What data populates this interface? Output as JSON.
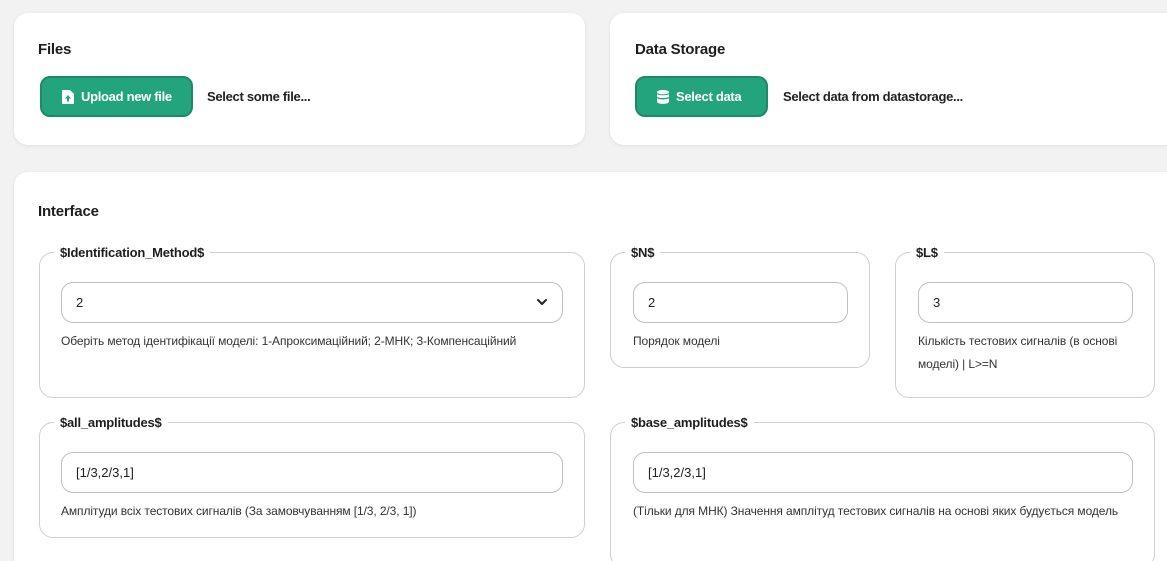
{
  "files": {
    "title": "Files",
    "upload_label": "Upload new file",
    "hint": "Select some file..."
  },
  "storage": {
    "title": "Data Storage",
    "select_label": "Select data",
    "hint": "Select data from datastorage..."
  },
  "interface": {
    "title": "Interface",
    "fields": {
      "method": {
        "label": "$Identification_Method$",
        "value": "2",
        "description": "Оберіть метод ідентифікації моделі: 1-Апроксимаційний; 2-МНК; 3-Компенсаційний"
      },
      "n": {
        "label": "$N$",
        "value": "2",
        "description": "Порядок моделі"
      },
      "l": {
        "label": "$L$",
        "value": "3",
        "description": "Кількість тестових сигналів (в основі моделі) | L>=N"
      },
      "all_amplitudes": {
        "label": "$all_amplitudes$",
        "value": "[1/3,2/3,1]",
        "description": "Амплітуди всіх тестових сигналів (За замовчуванням [1/3, 2/3, 1])"
      },
      "base_amplitudes": {
        "label": "$base_amplitudes$",
        "value": "[1/3,2/3,1]",
        "description": "(Тільки для МНК) Значення амплітуд тестових сигналів на основі яких будується модель"
      }
    }
  },
  "colors": {
    "accent": "#23a47c",
    "background": "#f2f2f2"
  }
}
